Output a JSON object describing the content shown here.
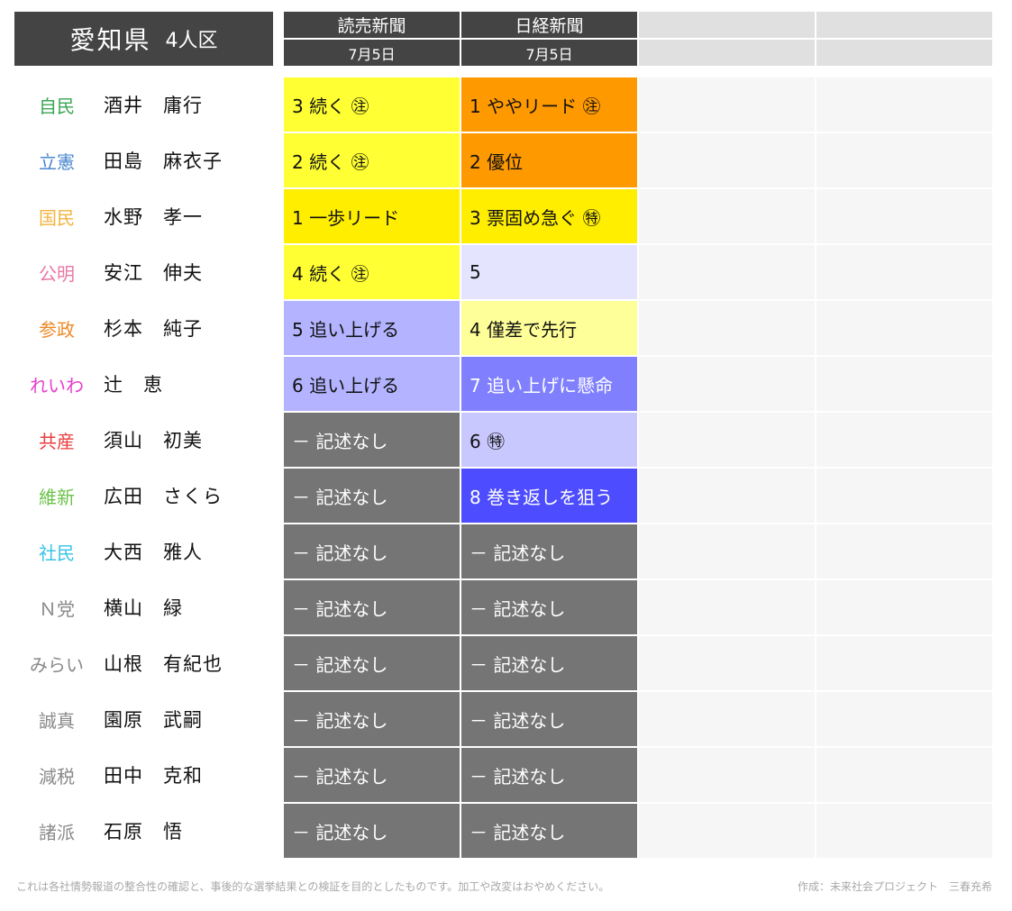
{
  "header": {
    "prefecture": "愛知県",
    "seats": "4人区",
    "columns": [
      {
        "name": "読売新聞",
        "date": "7月5日"
      },
      {
        "name": "日経新聞",
        "date": "7月5日"
      },
      {
        "name": "",
        "date": ""
      },
      {
        "name": "",
        "date": ""
      }
    ]
  },
  "rows": [
    {
      "party": "自民",
      "party_color": "#3aa655",
      "candidate": "酒井　庸行",
      "cells": [
        {
          "text": "3 続く ㊟",
          "bg": "#ffff33",
          "fg": "#111111"
        },
        {
          "text": "1 ややリード ㊟",
          "bg": "#ff9900",
          "fg": "#111111"
        }
      ]
    },
    {
      "party": "立憲",
      "party_color": "#4a88d0",
      "candidate": "田島　麻衣子",
      "cells": [
        {
          "text": "2 続く ㊟",
          "bg": "#ffff33",
          "fg": "#111111"
        },
        {
          "text": "2 優位",
          "bg": "#ff9900",
          "fg": "#111111"
        }
      ]
    },
    {
      "party": "国民",
      "party_color": "#f2b33d",
      "candidate": "水野　孝一",
      "cells": [
        {
          "text": "1 一歩リード",
          "bg": "#ffee00",
          "fg": "#111111"
        },
        {
          "text": "3 票固め急ぐ ㊕",
          "bg": "#ffee00",
          "fg": "#111111"
        }
      ]
    },
    {
      "party": "公明",
      "party_color": "#e87aa6",
      "candidate": "安江　伸夫",
      "cells": [
        {
          "text": "4 続く ㊟",
          "bg": "#ffff33",
          "fg": "#111111"
        },
        {
          "text": "5",
          "bg": "#e4e4ff",
          "fg": "#111111"
        }
      ]
    },
    {
      "party": "参政",
      "party_color": "#ef8a2a",
      "candidate": "杉本　純子",
      "cells": [
        {
          "text": "5 追い上げる",
          "bg": "#b3b3ff",
          "fg": "#111111"
        },
        {
          "text": "4 僅差で先行",
          "bg": "#ffff99",
          "fg": "#111111"
        }
      ]
    },
    {
      "party": "れいわ",
      "party_color": "#e83ecf",
      "candidate": "辻　恵",
      "cells": [
        {
          "text": "6 追い上げる",
          "bg": "#b3b3ff",
          "fg": "#111111"
        },
        {
          "text": "7 追い上げに懸命",
          "bg": "#8080ff",
          "fg": "#ffffff"
        }
      ]
    },
    {
      "party": "共産",
      "party_color": "#e83e3e",
      "candidate": "須山　初美",
      "cells": [
        {
          "text": "－ 記述なし",
          "bg": "#757575",
          "fg": "#ffffff"
        },
        {
          "text": "6 ㊕",
          "bg": "#c8c8ff",
          "fg": "#111111"
        }
      ]
    },
    {
      "party": "維新",
      "party_color": "#6cc24a",
      "candidate": "広田　さくら",
      "cells": [
        {
          "text": "－ 記述なし",
          "bg": "#757575",
          "fg": "#ffffff"
        },
        {
          "text": "8 巻き返しを狙う",
          "bg": "#4d4dff",
          "fg": "#ffffff"
        }
      ]
    },
    {
      "party": "社民",
      "party_color": "#36c3e8",
      "candidate": "大西　雅人",
      "cells": [
        {
          "text": "－ 記述なし",
          "bg": "#757575",
          "fg": "#ffffff"
        },
        {
          "text": "－ 記述なし",
          "bg": "#757575",
          "fg": "#ffffff"
        }
      ]
    },
    {
      "party": "Ｎ党",
      "party_color": "#8a8a8a",
      "candidate": "横山　緑",
      "cells": [
        {
          "text": "－ 記述なし",
          "bg": "#757575",
          "fg": "#ffffff"
        },
        {
          "text": "－ 記述なし",
          "bg": "#757575",
          "fg": "#ffffff"
        }
      ]
    },
    {
      "party": "みらい",
      "party_color": "#8a8a8a",
      "candidate": "山根　有紀也",
      "cells": [
        {
          "text": "－ 記述なし",
          "bg": "#757575",
          "fg": "#ffffff"
        },
        {
          "text": "－ 記述なし",
          "bg": "#757575",
          "fg": "#ffffff"
        }
      ]
    },
    {
      "party": "誠真",
      "party_color": "#8a8a8a",
      "candidate": "園原　武嗣",
      "cells": [
        {
          "text": "－ 記述なし",
          "bg": "#757575",
          "fg": "#ffffff"
        },
        {
          "text": "－ 記述なし",
          "bg": "#757575",
          "fg": "#ffffff"
        }
      ]
    },
    {
      "party": "減税",
      "party_color": "#8a8a8a",
      "candidate": "田中　克和",
      "cells": [
        {
          "text": "－ 記述なし",
          "bg": "#757575",
          "fg": "#ffffff"
        },
        {
          "text": "－ 記述なし",
          "bg": "#757575",
          "fg": "#ffffff"
        }
      ]
    },
    {
      "party": "諸派",
      "party_color": "#8a8a8a",
      "candidate": "石原　悟",
      "cells": [
        {
          "text": "－ 記述なし",
          "bg": "#757575",
          "fg": "#ffffff"
        },
        {
          "text": "－ 記述なし",
          "bg": "#757575",
          "fg": "#ffffff"
        }
      ]
    }
  ],
  "footer": {
    "disclaimer": "これは各社情勢報道の整合性の確認と、事後的な選挙結果との検証を目的としたものです。加工や改変はおやめください。",
    "credit": "作成：未来社会プロジェクト　三春充希"
  }
}
